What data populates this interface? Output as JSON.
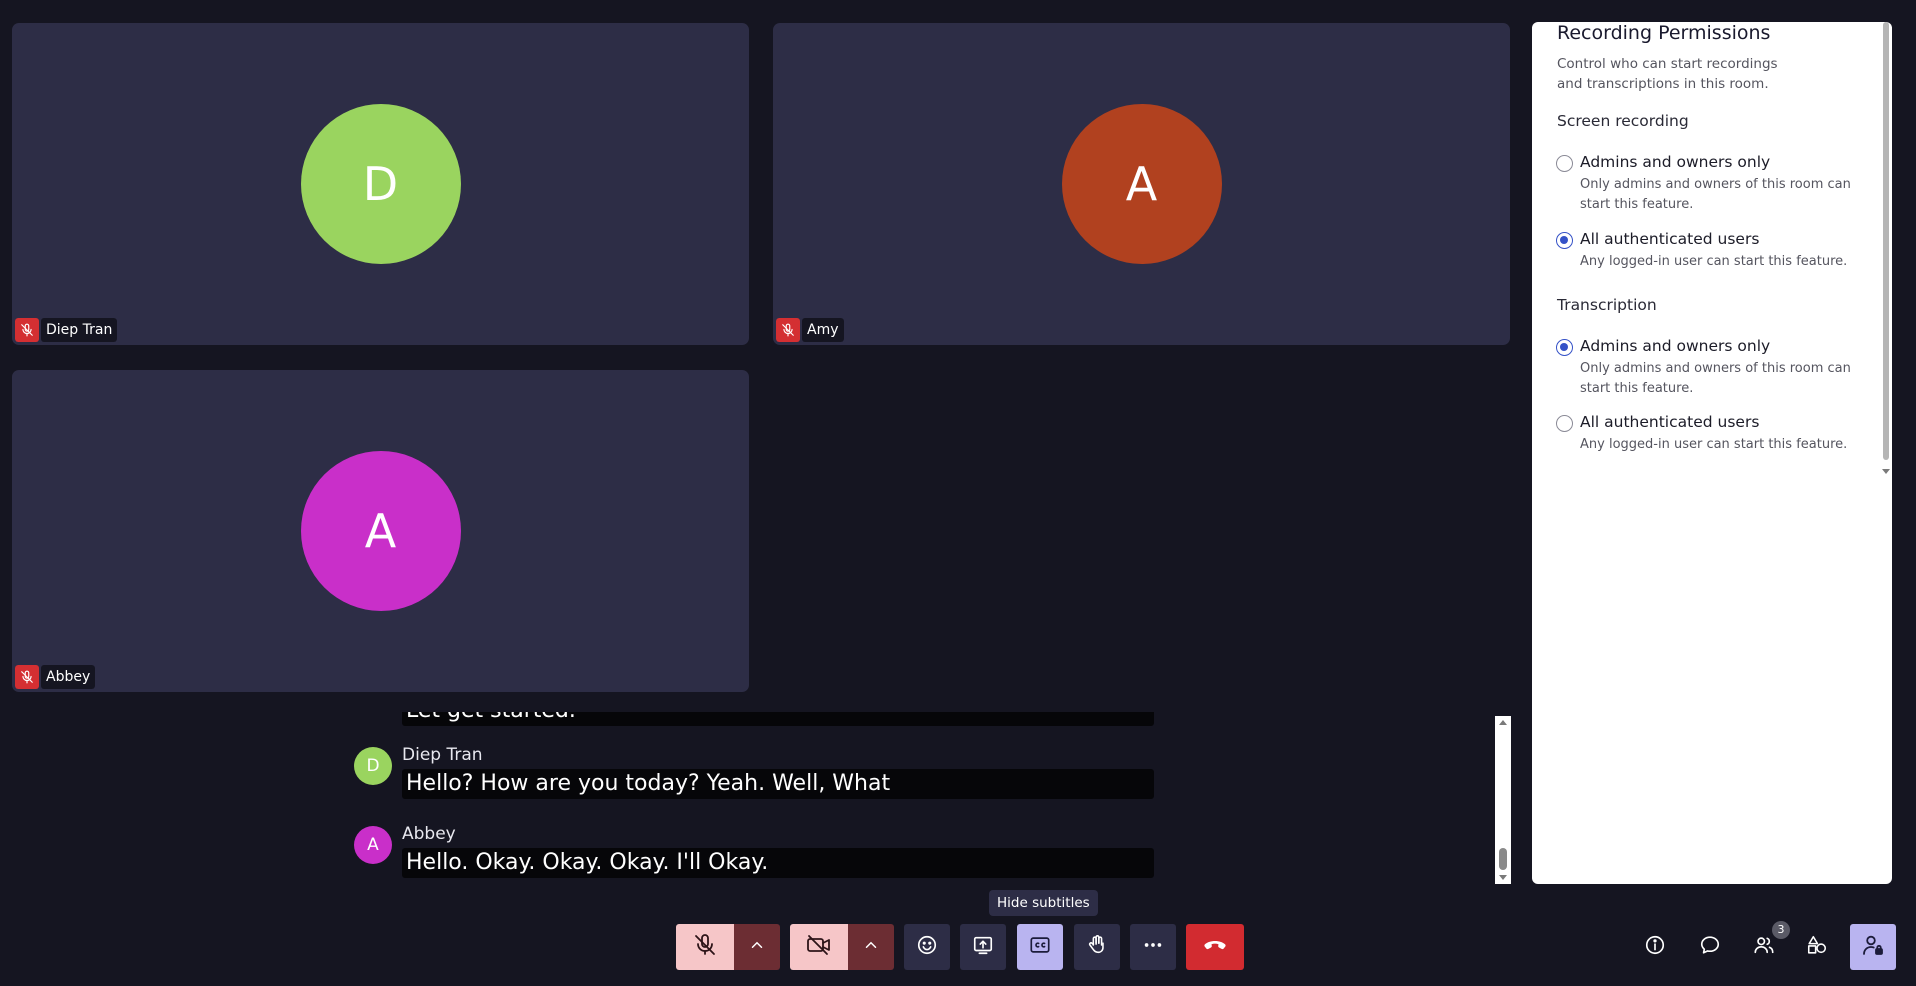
{
  "colors": {
    "tile_bg": "#2d2d46",
    "page_bg": "#151521",
    "muted_red": "#d42f32",
    "hangup_red": "#d22b30",
    "active_accent": "#b9b4f0",
    "radio_checked": "#3552c7"
  },
  "participants": [
    {
      "name": "Diep Tran",
      "initial": "D",
      "color": "#9ad45f",
      "mic_icon": "mic-off-icon"
    },
    {
      "name": "Amy",
      "initial": "A",
      "color": "#b1411f",
      "mic_icon": "mic-off-icon"
    },
    {
      "name": "Abbey",
      "initial": "A",
      "color": "#c92fc9",
      "mic_icon": "mic-off-icon"
    }
  ],
  "subtitles": {
    "partial_text": "Let get started.",
    "entries": [
      {
        "name": "Diep Tran",
        "initial": "D",
        "color": "#9ad45f",
        "text": "Hello? How are you today? Yeah. Well, What"
      },
      {
        "name": "Abbey",
        "initial": "A",
        "color": "#c92fc9",
        "text": "Hello. Okay. Okay. Okay. I'll Okay."
      }
    ]
  },
  "panel": {
    "title": "Recording Permissions",
    "description": "Control who can start recordings and transcriptions in this room.",
    "sections": [
      {
        "title": "Screen recording",
        "options": [
          {
            "label": "Admins and owners only",
            "description": "Only admins and owners of this room can start this feature.",
            "checked": false
          },
          {
            "label": "All authenticated users",
            "description": "Any logged-in user can start this feature.",
            "checked": true
          }
        ]
      },
      {
        "title": "Transcription",
        "options": [
          {
            "label": "Admins and owners only",
            "description": "Only admins and owners of this room can start this feature.",
            "checked": true
          },
          {
            "label": "All authenticated users",
            "description": "Any logged-in user can start this feature.",
            "checked": false
          }
        ]
      }
    ]
  },
  "toolbar": {
    "tooltip": "Hide subtitles",
    "buttons": [
      {
        "icon": "mic-off-icon",
        "state": "muted"
      },
      {
        "icon": "chevron-up-icon"
      },
      {
        "icon": "camera-off-icon",
        "state": "off"
      },
      {
        "icon": "chevron-up-icon"
      },
      {
        "icon": "emoji-icon"
      },
      {
        "icon": "screen-share-icon"
      },
      {
        "icon": "closed-captions-icon",
        "state": "active"
      },
      {
        "icon": "raise-hand-icon"
      },
      {
        "icon": "more-options-icon"
      },
      {
        "icon": "hang-up-icon"
      }
    ],
    "right_buttons": [
      {
        "icon": "info-icon"
      },
      {
        "icon": "chat-icon"
      },
      {
        "icon": "participants-icon",
        "badge": "3"
      },
      {
        "icon": "tools-icon"
      },
      {
        "icon": "admin-icon",
        "state": "active"
      }
    ]
  }
}
